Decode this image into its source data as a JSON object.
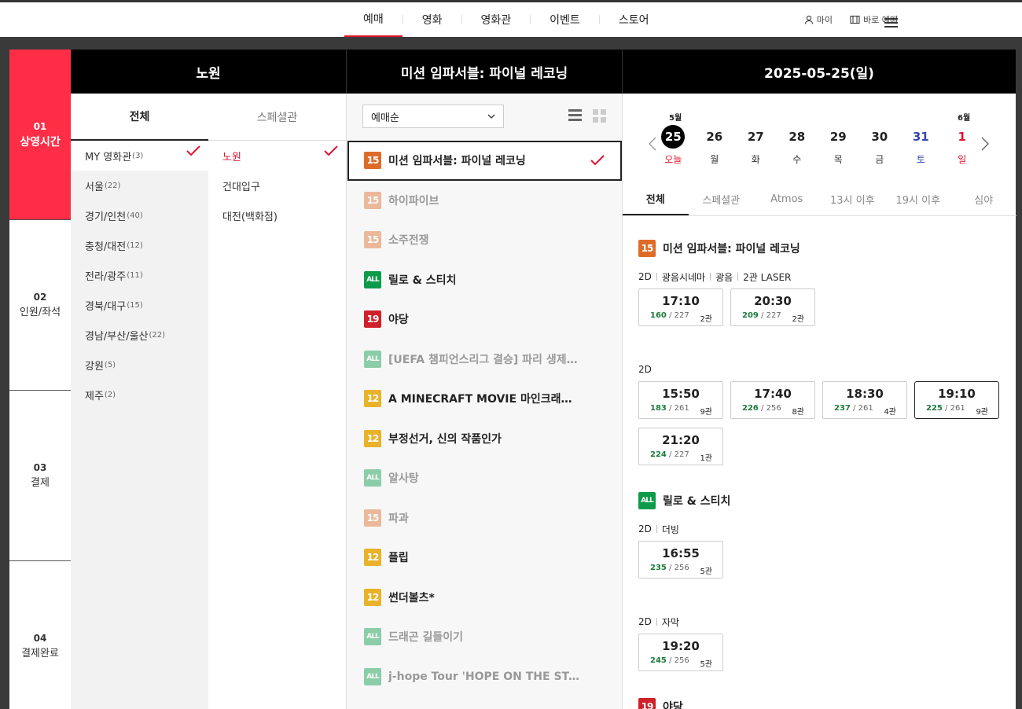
{
  "nav": {
    "items": [
      "예매",
      "영화",
      "영화관",
      "이벤트",
      "스토어"
    ],
    "active": 0,
    "my_label": "마이",
    "quick_label": "바로 예매"
  },
  "steps": [
    {
      "num": "01",
      "label": "상영시간",
      "active": true
    },
    {
      "num": "02",
      "label": "인원/좌석",
      "active": false
    },
    {
      "num": "03",
      "label": "결제",
      "active": false
    },
    {
      "num": "04",
      "label": "결제완료",
      "active": false
    }
  ],
  "headers": {
    "theater": "노원",
    "movie": "미션 임파서블: 파이널 레코닝",
    "date": "2025-05-25(일)"
  },
  "theater_tabs": [
    "전체",
    "스페셜관"
  ],
  "regions": [
    {
      "name": "MY 영화관",
      "count": "(3)"
    },
    {
      "name": "서울",
      "count": "(22)"
    },
    {
      "name": "경기/인천",
      "count": "(40)"
    },
    {
      "name": "충청/대전",
      "count": "(12)"
    },
    {
      "name": "전라/광주",
      "count": "(11)"
    },
    {
      "name": "경북/대구",
      "count": "(15)"
    },
    {
      "name": "경남/부산/울산",
      "count": "(22)"
    },
    {
      "name": "강원",
      "count": "(5)"
    },
    {
      "name": "제주",
      "count": "(2)"
    }
  ],
  "theaters": [
    "노원",
    "건대입구",
    "대전(백화점)"
  ],
  "sort": {
    "selected": "예매순"
  },
  "movies": [
    {
      "rating": "15",
      "title": "미션 임파서블: 파이널 레코닝",
      "state": "active"
    },
    {
      "rating": "15",
      "title": "하이파이브",
      "state": "dim"
    },
    {
      "rating": "15",
      "title": "소주전쟁",
      "state": "dim"
    },
    {
      "rating": "ALL",
      "title": "릴로 & 스티치",
      "state": "normal"
    },
    {
      "rating": "19",
      "title": "야당",
      "state": "normal"
    },
    {
      "rating": "ALL",
      "title": "[UEFA 챔피언스리그 결승] 파리 생제…",
      "state": "dim"
    },
    {
      "rating": "12",
      "title": "A MINECRAFT MOVIE 마인크래프트 …",
      "state": "normal"
    },
    {
      "rating": "12",
      "title": "부정선거, 신의 작품인가",
      "state": "normal"
    },
    {
      "rating": "ALL",
      "title": "알사탕",
      "state": "dim"
    },
    {
      "rating": "15",
      "title": "파과",
      "state": "dim"
    },
    {
      "rating": "12",
      "title": "플립",
      "state": "normal"
    },
    {
      "rating": "12",
      "title": "썬더볼츠*",
      "state": "normal"
    },
    {
      "rating": "ALL",
      "title": "드래곤 길들이기",
      "state": "dim"
    },
    {
      "rating": "ALL",
      "title": "j-hope Tour 'HOPE ON THE STAG…",
      "state": "dim"
    }
  ],
  "calendar": {
    "month_start": "5월",
    "month_next": "6월",
    "days": [
      {
        "n": "25",
        "w": "오늘",
        "type": "today"
      },
      {
        "n": "26",
        "w": "월",
        "type": "normal"
      },
      {
        "n": "27",
        "w": "화",
        "type": "normal"
      },
      {
        "n": "28",
        "w": "수",
        "type": "normal"
      },
      {
        "n": "29",
        "w": "목",
        "type": "normal"
      },
      {
        "n": "30",
        "w": "금",
        "type": "normal"
      },
      {
        "n": "31",
        "w": "토",
        "type": "sat"
      },
      {
        "n": "1",
        "w": "일",
        "type": "sun"
      }
    ]
  },
  "time_tabs": [
    "전체",
    "스페셜관",
    "Atmos",
    "13시 이후",
    "19시 이후",
    "심야"
  ],
  "schedule": [
    {
      "rating": "15",
      "title": "미션 임파서블: 파이널 레코닝",
      "groups": [
        {
          "format": [
            "2D",
            "광음시네마",
            "광음",
            "2관 LASER"
          ],
          "slots": [
            {
              "time": "17:10",
              "remain": "160",
              "total": "227",
              "hall": "2관"
            },
            {
              "time": "20:30",
              "remain": "209",
              "total": "227",
              "hall": "2관"
            }
          ]
        },
        {
          "format": [
            "2D"
          ],
          "slots": [
            {
              "time": "15:50",
              "remain": "183",
              "total": "261",
              "hall": "9관"
            },
            {
              "time": "17:40",
              "remain": "226",
              "total": "256",
              "hall": "8관"
            },
            {
              "time": "18:30",
              "remain": "237",
              "total": "261",
              "hall": "4관"
            },
            {
              "time": "19:10",
              "remain": "225",
              "total": "261",
              "hall": "9관",
              "selected": true
            },
            {
              "time": "21:20",
              "remain": "224",
              "total": "227",
              "hall": "1관"
            }
          ]
        }
      ]
    },
    {
      "rating": "ALL",
      "title": "릴로 & 스티치",
      "groups": [
        {
          "format": [
            "2D",
            "더빙"
          ],
          "slots": [
            {
              "time": "16:55",
              "remain": "235",
              "total": "256",
              "hall": "5관"
            }
          ]
        },
        {
          "format": [
            "2D",
            "자막"
          ],
          "slots": [
            {
              "time": "19:20",
              "remain": "245",
              "total": "256",
              "hall": "5관"
            }
          ]
        }
      ]
    },
    {
      "rating": "19",
      "title": "야당",
      "groups": []
    }
  ],
  "colors": {
    "accent": "#e3122c",
    "step_active": "#ff2d46",
    "rating_15": "#dd6c2a",
    "rating_12": "#e8b229",
    "rating_19": "#d02029",
    "rating_all": "#0d9b4b"
  }
}
